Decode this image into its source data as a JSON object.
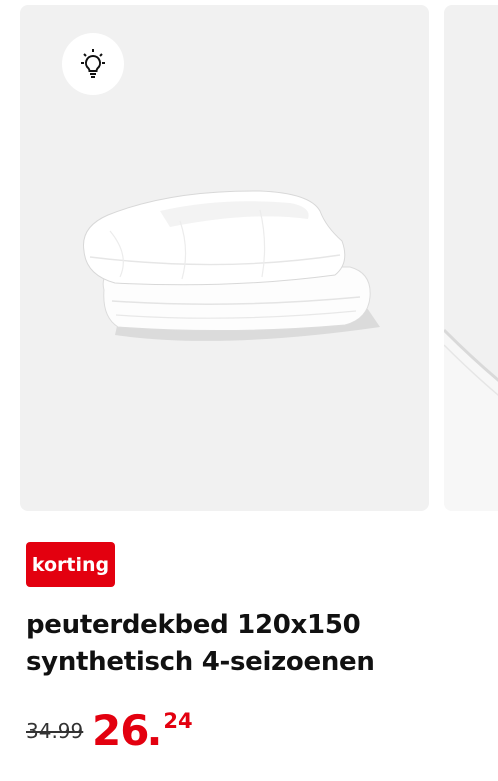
{
  "gallery": {
    "images": [
      {
        "icon": "lightbulb-icon",
        "subject": "folded-duvet"
      },
      {
        "subject": "duvet-corner"
      }
    ]
  },
  "badge": {
    "label": "korting",
    "color": "#e3000f"
  },
  "product": {
    "title": "peuterdekbed 120x150 synthetisch 4-seizoenen"
  },
  "price": {
    "old": "34.99",
    "new_whole": "26",
    "new_separator": ".",
    "new_cents": "24",
    "color": "#e3000f"
  }
}
